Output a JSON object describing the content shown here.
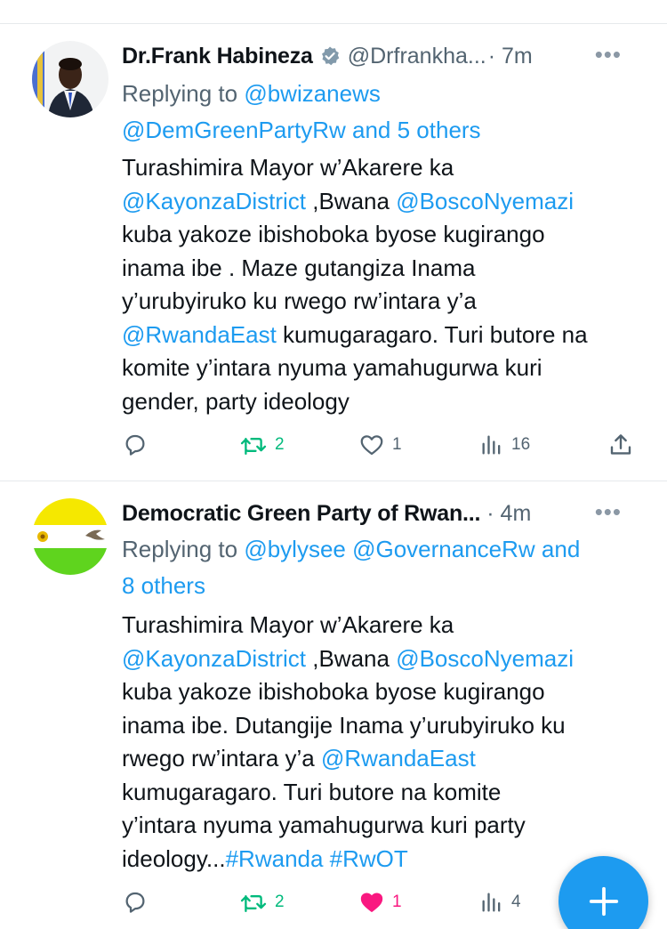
{
  "colors": {
    "link": "#1d9bf0",
    "secondary_text": "#536471",
    "retweet_green": "#00ba7c",
    "like_pink": "#f91880",
    "fab_blue": "#1d9bf0"
  },
  "tweets": [
    {
      "author_name": "Dr.Frank Habineza",
      "verified": true,
      "handle": "@Drfrankha...",
      "time": "· 7m",
      "more_icon": "more-horizontal-icon",
      "replying_label": "Replying to",
      "replying_to_1": "@bwizanews",
      "replying_to_2": "@DemGreenPartyRw and 5 others",
      "body": {
        "l1": "Turashimira Mayor w’Akarere ka",
        "l2_link1": "@KayonzaDistrict",
        "l2_text": " ,Bwana ",
        "l2_link2": "@BoscoNyemazi",
        "l3": "kuba yakoze ibishoboka byose kugirango",
        "l4": "inama ibe . Maze gutangiza Inama",
        "l5": "y’urubyiruko ku rwego rw’intara y’a",
        "l6_link": "@RwandaEast",
        "l6_text": " kumugaragaro. Turi butore na",
        "l7": "komite y’intara nyuma yamahugurwa kuri",
        "l8": "gender, party ideology"
      },
      "actions": {
        "reply_count": "",
        "retweet_count": "2",
        "like_count": "1",
        "like_active": false,
        "views_count": "16"
      }
    },
    {
      "author_name": "Democratic Green Party of Rwan...",
      "verified": false,
      "handle": "",
      "time": "· 4m",
      "more_icon": "more-horizontal-icon",
      "replying_label": "Replying to",
      "replying_to_1": "@bylysee @GovernanceRw and",
      "replying_to_2": "8 others",
      "body": {
        "l1": "Turashimira Mayor w’Akarere ka",
        "l2_link1": "@KayonzaDistrict",
        "l2_text": " ,Bwana ",
        "l2_link2": "@BoscoNyemazi",
        "l3": "kuba yakoze ibishoboka byose kugirango",
        "l4": "inama ibe. Dutangije Inama y’urubyiruko ku",
        "l5_text": "rwego rw’intara y’a ",
        "l5_link": "@RwandaEast",
        "l6": "kumugaragaro. Turi butore na komite",
        "l7": "y’intara nyuma yamahugurwa kuri party",
        "l8_text": "ideology...",
        "l8_link": "#Rwanda #RwOT"
      },
      "actions": {
        "reply_count": "",
        "retweet_count": "2",
        "like_count": "1",
        "like_active": true,
        "views_count": "4"
      }
    }
  ],
  "fab": {
    "icon": "plus-icon",
    "label": "+"
  }
}
